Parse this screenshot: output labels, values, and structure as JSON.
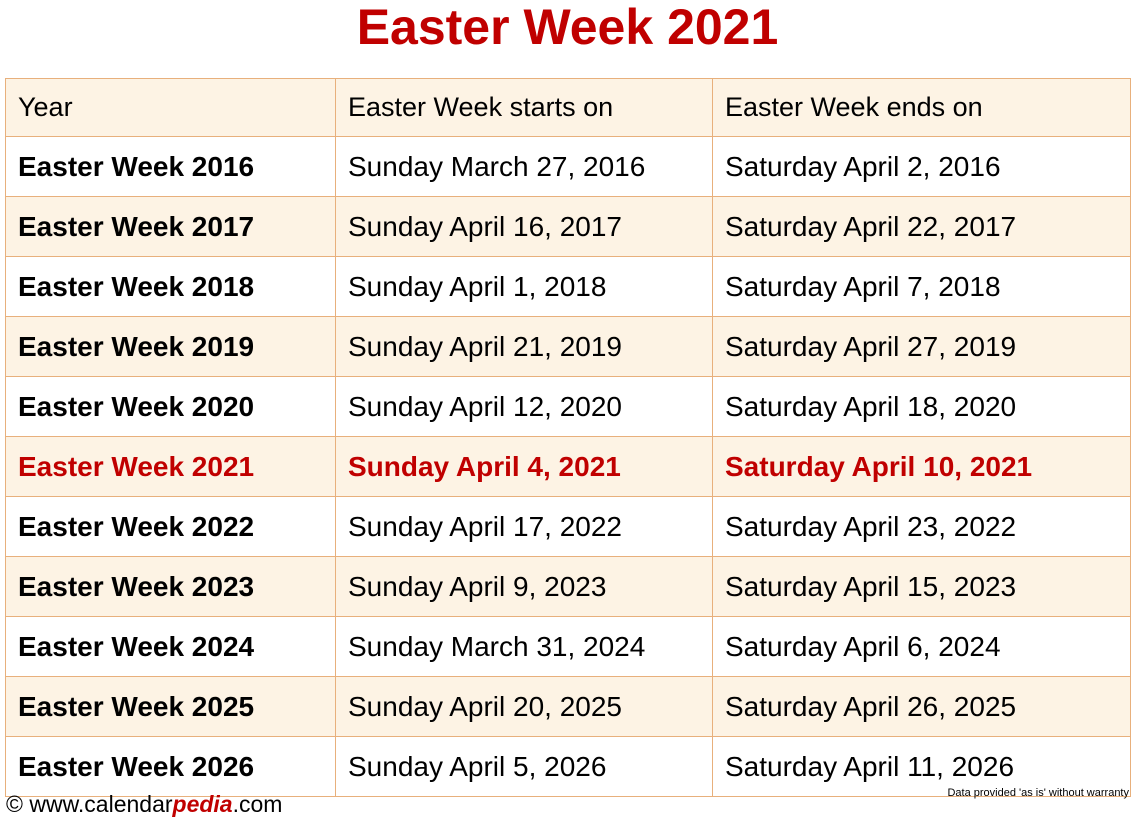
{
  "page": {
    "title": "Easter Week 2021",
    "title_color": "#c00000",
    "background_color": "#ffffff"
  },
  "table": {
    "border_color": "#e8b07c",
    "cream_row_color": "#fdf3e4",
    "white_row_color": "#ffffff",
    "highlight_text_color": "#c00000",
    "columns": [
      "Year",
      "Easter Week starts on",
      "Easter Week ends on"
    ],
    "rows": [
      {
        "year": "Easter Week 2016",
        "starts": "Sunday March 27, 2016",
        "ends": "Saturday April 2, 2016",
        "shade": "white",
        "highlight": false
      },
      {
        "year": "Easter Week 2017",
        "starts": "Sunday April 16, 2017",
        "ends": "Saturday April 22, 2017",
        "shade": "cream",
        "highlight": false
      },
      {
        "year": "Easter Week 2018",
        "starts": "Sunday April 1, 2018",
        "ends": "Saturday April 7, 2018",
        "shade": "white",
        "highlight": false
      },
      {
        "year": "Easter Week 2019",
        "starts": "Sunday April 21, 2019",
        "ends": "Saturday April 27, 2019",
        "shade": "cream",
        "highlight": false
      },
      {
        "year": "Easter Week 2020",
        "starts": "Sunday April 12, 2020",
        "ends": "Saturday April 18, 2020",
        "shade": "white",
        "highlight": false
      },
      {
        "year": "Easter Week 2021",
        "starts": "Sunday April 4, 2021",
        "ends": "Saturday April 10, 2021",
        "shade": "cream",
        "highlight": true
      },
      {
        "year": "Easter Week 2022",
        "starts": "Sunday April 17, 2022",
        "ends": "Saturday April 23, 2022",
        "shade": "white",
        "highlight": false
      },
      {
        "year": "Easter Week 2023",
        "starts": "Sunday April 9, 2023",
        "ends": "Saturday April 15, 2023",
        "shade": "cream",
        "highlight": false
      },
      {
        "year": "Easter Week 2024",
        "starts": "Sunday March 31, 2024",
        "ends": "Saturday April 6, 2024",
        "shade": "white",
        "highlight": false
      },
      {
        "year": "Easter Week 2025",
        "starts": "Sunday April 20, 2025",
        "ends": "Saturday April 26, 2025",
        "shade": "cream",
        "highlight": false
      },
      {
        "year": "Easter Week 2026",
        "starts": "Sunday April 5, 2026",
        "ends": "Saturday April 11, 2026",
        "shade": "white",
        "highlight": false
      }
    ]
  },
  "footer": {
    "copyright_symbol": "©",
    "site_prefix": " www.calendar",
    "site_accent": "pedia",
    "site_suffix": ".com",
    "disclaimer": "Data provided 'as is' without warranty"
  }
}
